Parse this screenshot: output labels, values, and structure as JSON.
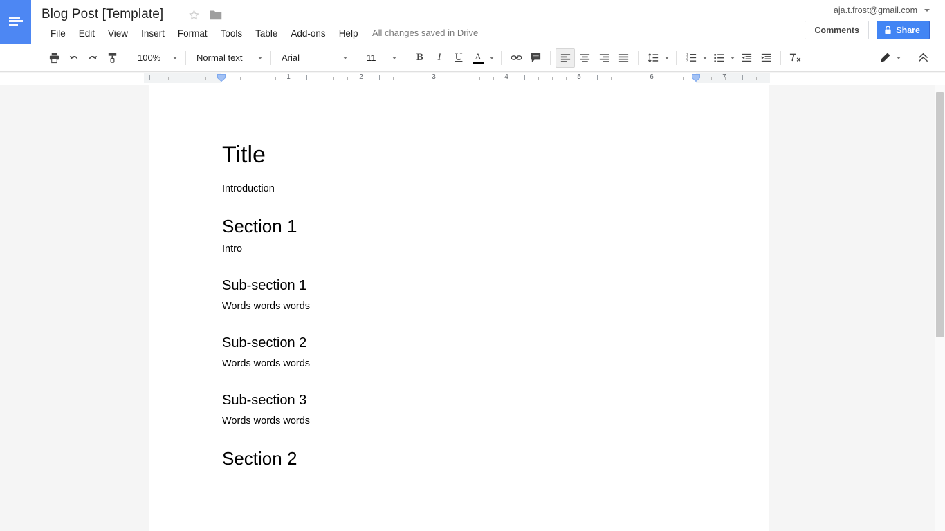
{
  "app": {
    "name": "Google Docs",
    "logo_icon": "docs-lines-icon"
  },
  "header": {
    "document_title": "Blog Post [Template]",
    "star_icon": "star-outline-icon",
    "folder_icon": "folder-icon",
    "save_status": "All changes saved in Drive",
    "account_email": "aja.t.frost@gmail.com",
    "account_caret_icon": "chevron-down-icon",
    "comments_label": "Comments",
    "share_label": "Share",
    "share_lock_icon": "lock-icon",
    "share_color": "#4285f4",
    "menus": [
      {
        "label": "File"
      },
      {
        "label": "Edit"
      },
      {
        "label": "View"
      },
      {
        "label": "Insert"
      },
      {
        "label": "Format"
      },
      {
        "label": "Tools"
      },
      {
        "label": "Table"
      },
      {
        "label": "Add-ons"
      },
      {
        "label": "Help"
      }
    ]
  },
  "toolbar": {
    "print_icon": "print-icon",
    "undo_icon": "undo-icon",
    "redo_icon": "redo-icon",
    "paint_format_icon": "paint-format-icon",
    "zoom_value": "100%",
    "style_value": "Normal text",
    "font_value": "Arial",
    "font_size_value": "11",
    "bold_label": "B",
    "italic_label": "I",
    "underline_label": "U",
    "text_color_label": "A",
    "text_color_value": "#000000",
    "link_icon": "link-icon",
    "comment_icon": "add-comment-icon",
    "align_left_icon": "align-left-icon",
    "align_center_icon": "align-center-icon",
    "align_right_icon": "align-right-icon",
    "align_justify_icon": "align-justify-icon",
    "active_alignment": "align-left",
    "line_spacing_icon": "line-spacing-icon",
    "numbered_list_icon": "numbered-list-icon",
    "bulleted_list_icon": "bulleted-list-icon",
    "decrease_indent_icon": "decrease-indent-icon",
    "increase_indent_icon": "increase-indent-icon",
    "clear_formatting_icon": "clear-formatting-icon",
    "edit_mode_icon": "pencil-icon",
    "collapse_toolbar_icon": "double-chevron-up-icon"
  },
  "ruler": {
    "numbers": [
      "1",
      "2",
      "3",
      "4",
      "5",
      "6",
      "7"
    ],
    "left_indent_marker": "left-indent-marker",
    "right_indent_marker": "right-indent-marker",
    "unit": "inches"
  },
  "document": {
    "blocks": [
      {
        "type": "title",
        "text": "Title"
      },
      {
        "type": "body",
        "text": "Introduction"
      },
      {
        "type": "h1",
        "text": "Section 1"
      },
      {
        "type": "body",
        "text": "Intro"
      },
      {
        "type": "h2",
        "text": "Sub-section 1"
      },
      {
        "type": "body",
        "text": "Words words words"
      },
      {
        "type": "h2",
        "text": "Sub-section 2"
      },
      {
        "type": "body",
        "text": "Words words words"
      },
      {
        "type": "h2",
        "text": "Sub-section 3"
      },
      {
        "type": "body",
        "text": "Words words words"
      },
      {
        "type": "h1",
        "text": "Section 2"
      }
    ]
  },
  "scrollbar": {
    "orientation": "vertical"
  }
}
